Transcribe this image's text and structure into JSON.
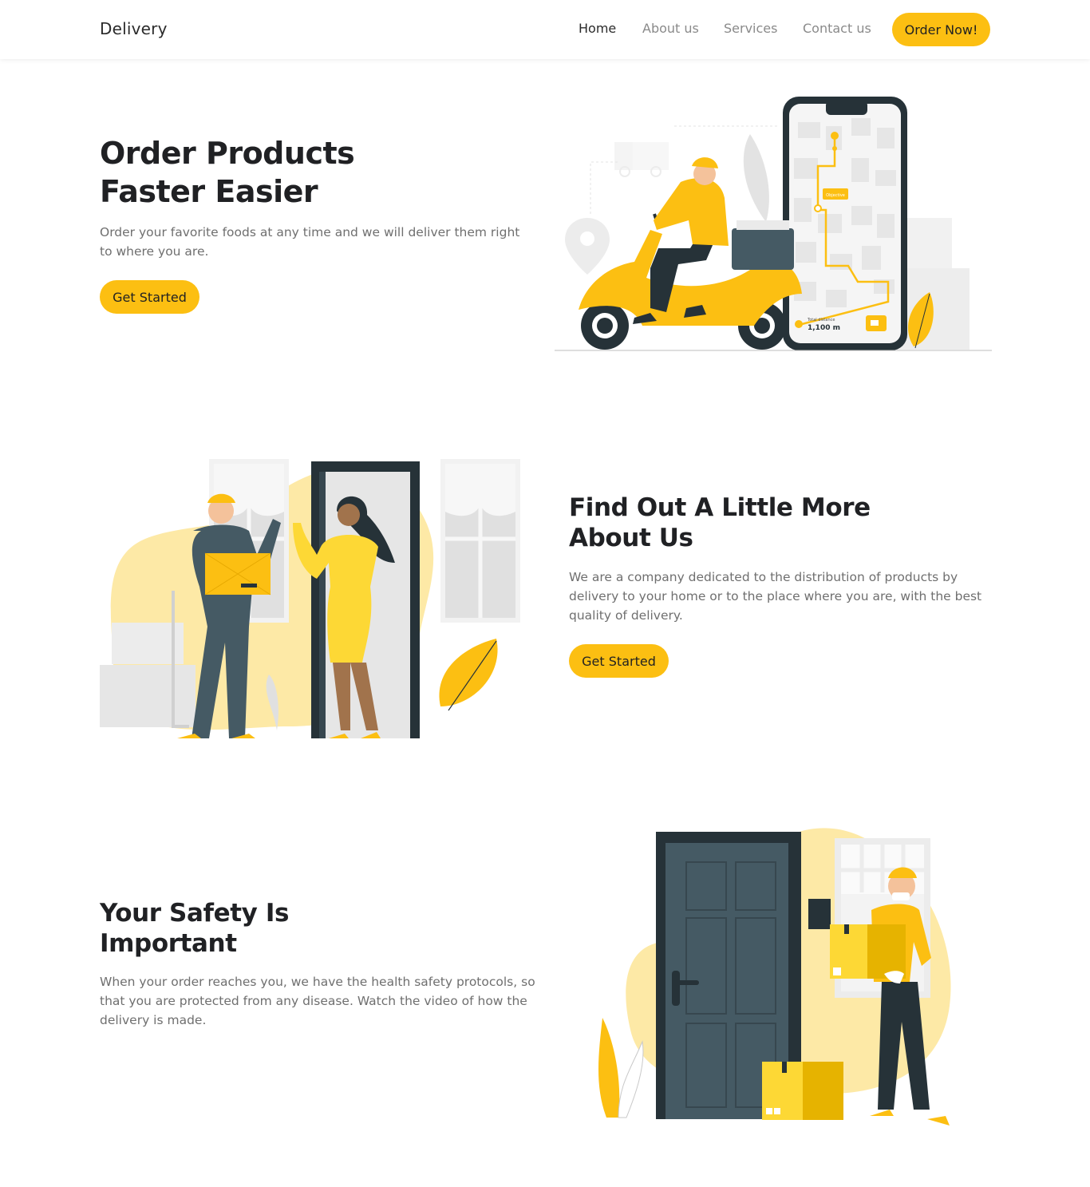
{
  "header": {
    "brand": "Delivery",
    "nav": [
      "Home",
      "About us",
      "Services",
      "Contact us"
    ],
    "cta": "Order Now!"
  },
  "hero": {
    "title_line1": "Order Products",
    "title_line2": "Faster Easier",
    "text": "Order your favorite foods at any time and we will deliver them right to where you are.",
    "button": "Get Started",
    "illustration": {
      "distance_label": "Total distance",
      "distance_value": "1,100 m",
      "map_tag": "Objective"
    }
  },
  "about": {
    "title_line1": "Find Out A Little More",
    "title_line2": "About Us",
    "text": "We are a company dedicated to the distribution of products by delivery to your home or to the place where you are, with the best quality of delivery.",
    "button": "Get Started"
  },
  "safety": {
    "title_line1": "Your Safety Is",
    "title_line2": "Important",
    "text": "When your order reaches you, we have the health safety protocols, so that you are protected from any disease. Watch the video of how the delivery is made."
  },
  "colors": {
    "accent": "#fcbf12",
    "dark": "#263238",
    "slate": "#455a64",
    "light_yellow": "#fde9a6"
  }
}
